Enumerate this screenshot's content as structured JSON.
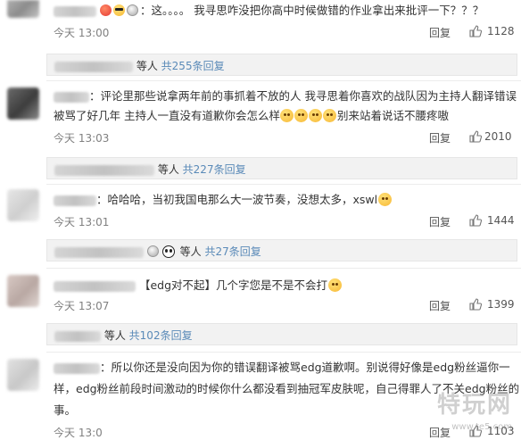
{
  "reply_label": "回复",
  "comments": [
    {
      "text_lines": [
        "：这。。。。  我寻思咋没把你高中时候做错的作业拿出来批评一下？？？"
      ],
      "time": "今天 13:00",
      "likes": "1128"
    },
    {
      "text_lines": [
        "：评论里那些说拿两年前的事抓着不放的人 我寻思着你喜欢的战队因为主持人翻译错误",
        "被骂了好几年 主持人一直没有道歉你会怎么样",
        "别来站着说话不腰疼嗷"
      ],
      "time": "今天 13:03",
      "likes": "2010"
    },
    {
      "text_lines": [
        "：哈哈哈，当初我国电那么大一波节奏，没想太多，xswl"
      ],
      "time": "今天 13:01",
      "likes": "1444"
    },
    {
      "text_lines": [
        "【edg对不起】几个字您是不是不会打"
      ],
      "time": "今天 13:07",
      "likes": "1399"
    },
    {
      "text_lines": [
        "：所以你还是没向因为你的错误翻译被骂edg道歉啊。别说得好像是edg粉丝逼你一",
        "样，edg粉丝前段时间激动的时候你什么都没看到抽冠军皮肤呢，自己得罪人了不关edg粉丝的",
        "事。"
      ],
      "time": "今天 13:0",
      "likes": "1103"
    }
  ],
  "reply_threads": [
    {
      "prefix": "等人",
      "link": "共255条回复"
    },
    {
      "prefix": "等人",
      "link": "共227条回复"
    },
    {
      "prefix": "等人",
      "link": "共27条回复"
    },
    {
      "prefix": "等人",
      "link": "共102条回复"
    }
  ],
  "icons": {
    "thumb": "thumbs-up-icon",
    "face": "laughing-face-emoji",
    "panda": "panda-icon"
  },
  "colors": {
    "link": "#5a8ab8",
    "meta": "#808080",
    "reply_bg": "#f2f2f2"
  },
  "watermark": {
    "logo": "特玩网",
    "url": "www.te5.com"
  }
}
